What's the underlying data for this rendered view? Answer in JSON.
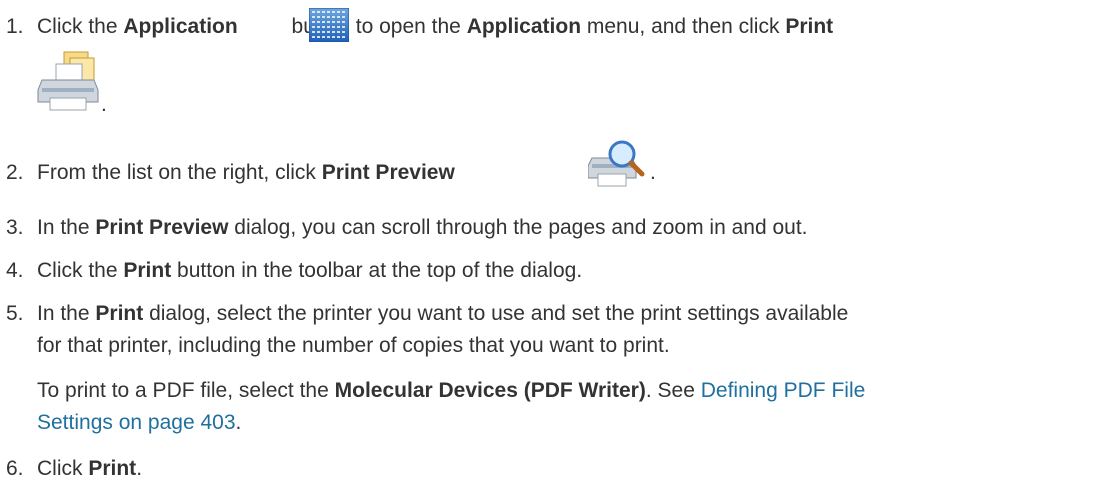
{
  "steps": [
    {
      "num": "1.",
      "t1": "Click the ",
      "b1": "Application",
      "t2": " button to open the ",
      "b2": "Application",
      "t3": " menu, and then click ",
      "b3": "Print",
      "after_icon": "."
    },
    {
      "num": "2.",
      "t1": "From the list on the right, click ",
      "b1": "Print Preview",
      "after_icon": "."
    },
    {
      "num": "3.",
      "t1": "In the ",
      "b1": "Print Preview",
      "t2": " dialog, you can scroll through the pages and zoom in and out."
    },
    {
      "num": "4.",
      "t1": "Click the ",
      "b1": "Print",
      "t2": " button in the toolbar at the top of the dialog."
    },
    {
      "num": "5.",
      "t1": "In the ",
      "b1": "Print",
      "t2": " dialog, select the printer you want to use and set the print settings available",
      "line2": "for that printer, including the number of copies that you want to print.",
      "note_t1": "To print to a PDF file, select the ",
      "note_b1": "Molecular Devices (PDF Writer)",
      "note_t2": ". See ",
      "link_line1": "Defining PDF File",
      "link_line2": "Settings on page 403",
      "note_end": "."
    },
    {
      "num": "6.",
      "t1": "Click ",
      "b1": "Print",
      "t2": "."
    }
  ],
  "icons": [
    "application-button-icon",
    "print-icon",
    "print-preview-icon"
  ]
}
